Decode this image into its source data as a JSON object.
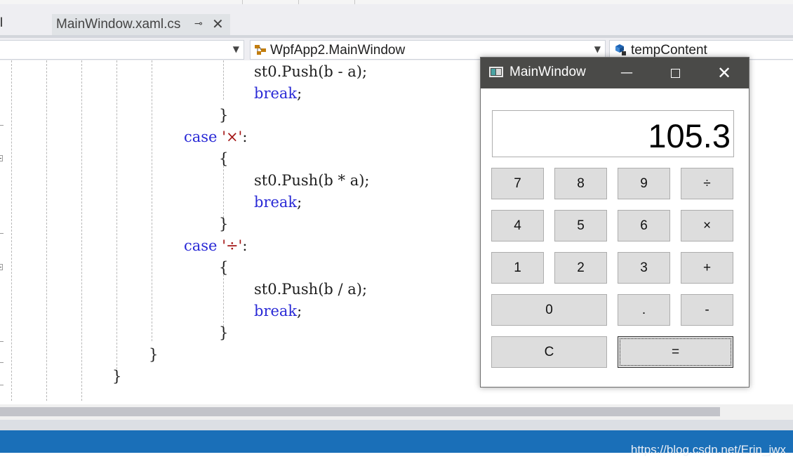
{
  "ide": {
    "left_tab_fragment": "l",
    "active_tab": {
      "title": "MainWindow.xaml.cs",
      "pin_glyph": "⊸",
      "close_glyph": "✕"
    },
    "nav": {
      "class_combo": "WpfApp2.MainWindow",
      "member_combo": "tempContent"
    },
    "watermark": "https://blog.csdn.net/Erin_jwx"
  },
  "code_lines": [
    {
      "indent": 362,
      "parts": [
        {
          "t": "st0.Push(b - a);",
          "c": "plain"
        }
      ]
    },
    {
      "indent": 362,
      "parts": [
        {
          "t": "break",
          "c": "kw"
        },
        {
          "t": ";",
          "c": "plain"
        }
      ]
    },
    {
      "indent": 312,
      "parts": [
        {
          "t": "}",
          "c": "plain"
        }
      ]
    },
    {
      "indent": 262,
      "parts": [
        {
          "t": "case",
          "c": "kw"
        },
        {
          "t": " ",
          "c": "plain"
        },
        {
          "t": "'×'",
          "c": "str"
        },
        {
          "t": ":",
          "c": "plain"
        }
      ]
    },
    {
      "indent": 312,
      "parts": [
        {
          "t": "{",
          "c": "plain"
        }
      ]
    },
    {
      "indent": 362,
      "parts": [
        {
          "t": "st0.Push(b * a);",
          "c": "plain"
        }
      ]
    },
    {
      "indent": 362,
      "parts": [
        {
          "t": "break",
          "c": "kw"
        },
        {
          "t": ";",
          "c": "plain"
        }
      ]
    },
    {
      "indent": 312,
      "parts": [
        {
          "t": "}",
          "c": "plain"
        }
      ]
    },
    {
      "indent": 262,
      "parts": [
        {
          "t": "case",
          "c": "kw"
        },
        {
          "t": " ",
          "c": "plain"
        },
        {
          "t": "'÷'",
          "c": "str"
        },
        {
          "t": ":",
          "c": "plain"
        }
      ]
    },
    {
      "indent": 312,
      "parts": [
        {
          "t": "{",
          "c": "plain"
        }
      ]
    },
    {
      "indent": 362,
      "parts": [
        {
          "t": "st0.Push(b / a);",
          "c": "plain"
        }
      ]
    },
    {
      "indent": 362,
      "parts": [
        {
          "t": "break",
          "c": "kw"
        },
        {
          "t": ";",
          "c": "plain"
        }
      ]
    },
    {
      "indent": 312,
      "parts": [
        {
          "t": "}",
          "c": "plain"
        }
      ]
    },
    {
      "indent": 212,
      "parts": [
        {
          "t": "}",
          "c": "plain"
        }
      ]
    },
    {
      "indent": 160,
      "parts": [
        {
          "t": "}",
          "c": "plain"
        }
      ]
    }
  ],
  "calculator": {
    "title": "MainWindow",
    "min_glyph": "—",
    "close_glyph": "✕",
    "display": "105.3",
    "keys": [
      {
        "label": "7",
        "name": "key-7"
      },
      {
        "label": "8",
        "name": "key-8"
      },
      {
        "label": "9",
        "name": "key-9"
      },
      {
        "label": "÷",
        "name": "key-divide"
      },
      {
        "label": "4",
        "name": "key-4"
      },
      {
        "label": "5",
        "name": "key-5"
      },
      {
        "label": "6",
        "name": "key-6"
      },
      {
        "label": "×",
        "name": "key-multiply"
      },
      {
        "label": "1",
        "name": "key-1"
      },
      {
        "label": "2",
        "name": "key-2"
      },
      {
        "label": "3",
        "name": "key-3"
      },
      {
        "label": "+",
        "name": "key-plus"
      },
      {
        "label": "0",
        "name": "key-0"
      },
      {
        "label": ".",
        "name": "key-decimal"
      },
      {
        "label": "-",
        "name": "key-minus"
      },
      {
        "label": "C",
        "name": "key-clear"
      },
      {
        "label": "=",
        "name": "key-equals"
      }
    ]
  }
}
